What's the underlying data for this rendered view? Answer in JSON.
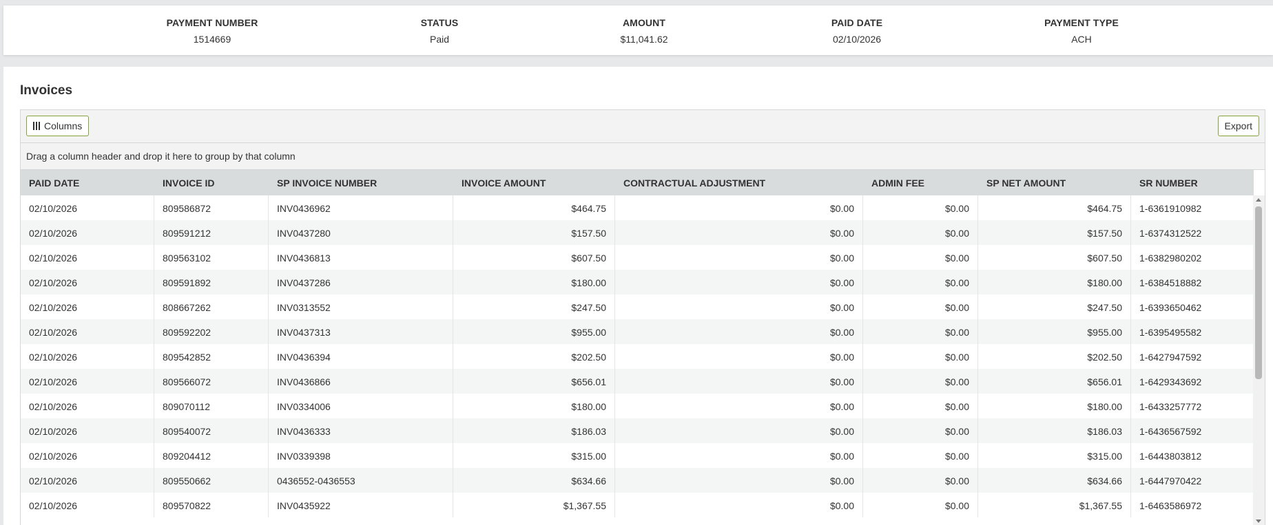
{
  "summary": [
    {
      "label": "PAYMENT NUMBER",
      "value": "1514669"
    },
    {
      "label": "STATUS",
      "value": "Paid"
    },
    {
      "label": "AMOUNT",
      "value": "$11,041.62"
    },
    {
      "label": "PAID DATE",
      "value": "02/10/2026"
    },
    {
      "label": "PAYMENT TYPE",
      "value": "ACH"
    }
  ],
  "invoices": {
    "title": "Invoices",
    "columns_button": "Columns",
    "export_button": "Export",
    "group_hint": "Drag a column header and drop it here to group by that column",
    "headers": [
      "PAID DATE",
      "INVOICE ID",
      "SP INVOICE NUMBER",
      "INVOICE AMOUNT",
      "CONTRACTUAL ADJUSTMENT",
      "ADMIN FEE",
      "SP NET AMOUNT",
      "SR NUMBER"
    ],
    "rows": [
      [
        "02/10/2026",
        "809586872",
        "INV0436962",
        "$464.75",
        "$0.00",
        "$0.00",
        "$464.75",
        "1-6361910982"
      ],
      [
        "02/10/2026",
        "809591212",
        "INV0437280",
        "$157.50",
        "$0.00",
        "$0.00",
        "$157.50",
        "1-6374312522"
      ],
      [
        "02/10/2026",
        "809563102",
        "INV0436813",
        "$607.50",
        "$0.00",
        "$0.00",
        "$607.50",
        "1-6382980202"
      ],
      [
        "02/10/2026",
        "809591892",
        "INV0437286",
        "$180.00",
        "$0.00",
        "$0.00",
        "$180.00",
        "1-6384518882"
      ],
      [
        "02/10/2026",
        "808667262",
        "INV0313552",
        "$247.50",
        "$0.00",
        "$0.00",
        "$247.50",
        "1-6393650462"
      ],
      [
        "02/10/2026",
        "809592202",
        "INV0437313",
        "$955.00",
        "$0.00",
        "$0.00",
        "$955.00",
        "1-6395495582"
      ],
      [
        "02/10/2026",
        "809542852",
        "INV0436394",
        "$202.50",
        "$0.00",
        "$0.00",
        "$202.50",
        "1-6427947592"
      ],
      [
        "02/10/2026",
        "809566072",
        "INV0436866",
        "$656.01",
        "$0.00",
        "$0.00",
        "$656.01",
        "1-6429343692"
      ],
      [
        "02/10/2026",
        "809070112",
        "INV0334006",
        "$180.00",
        "$0.00",
        "$0.00",
        "$180.00",
        "1-6433257772"
      ],
      [
        "02/10/2026",
        "809540072",
        "INV0436333",
        "$186.03",
        "$0.00",
        "$0.00",
        "$186.03",
        "1-6436567592"
      ],
      [
        "02/10/2026",
        "809204412",
        "INV0339398",
        "$315.00",
        "$0.00",
        "$0.00",
        "$315.00",
        "1-6443803812"
      ],
      [
        "02/10/2026",
        "809550662",
        "0436552-0436553",
        "$634.66",
        "$0.00",
        "$0.00",
        "$634.66",
        "1-6447970422"
      ],
      [
        "02/10/2026",
        "809570822",
        "INV0435922",
        "$1,367.55",
        "$0.00",
        "$0.00",
        "$1,367.55",
        "1-6463586972"
      ]
    ]
  }
}
